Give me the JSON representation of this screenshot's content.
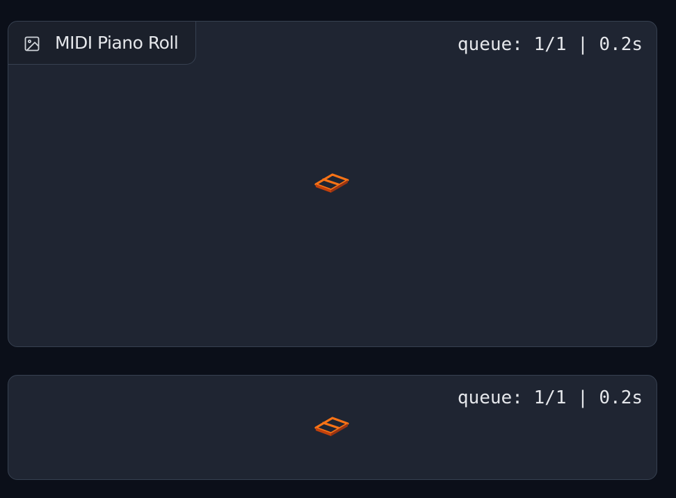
{
  "top_panel": {
    "label": "MIDI Piano Roll",
    "label_icon": "image-icon",
    "queue_status": "queue: 1/1 | 0.2s",
    "loader_icon": "loading-spinner-icon"
  },
  "bottom_panel": {
    "queue_status": "queue: 1/1 | 0.2s",
    "loader_icon": "loading-spinner-icon"
  },
  "colors": {
    "background": "#0b0f19",
    "panel": "#1f2532",
    "border": "#374151",
    "text": "#e5e7eb",
    "loader_accent": "#f97316"
  }
}
